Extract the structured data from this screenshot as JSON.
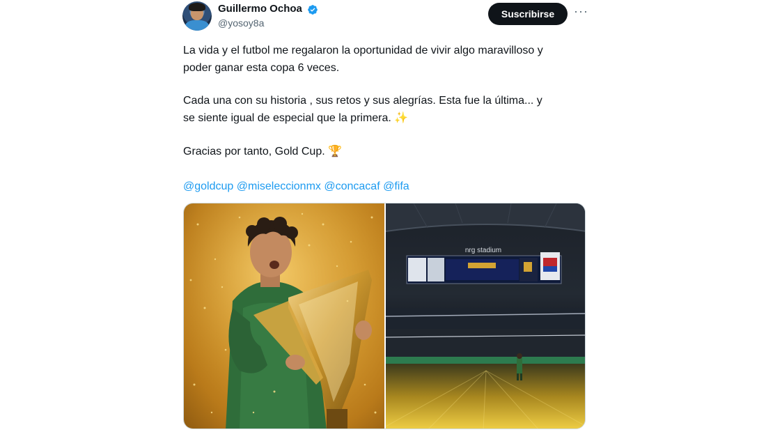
{
  "author": {
    "name": "Guillermo Ochoa",
    "handle": "@yosoy8a",
    "verified": true
  },
  "actions": {
    "subscribe_label": "Suscribirse",
    "more_label": "···"
  },
  "tweet": {
    "paragraph1_line1": "La vida y el futbol me regalaron la oportunidad de vivir algo maravilloso y",
    "paragraph1_line2": "poder ganar esta copa 6 veces.",
    "paragraph2_line1": "Cada una con su historia , sus retos y sus alegrías. Esta fue la última... y",
    "paragraph2_line2": "se siente igual de especial que la primera. ✨",
    "paragraph3": "Gracias por tanto, Gold Cup. 🏆",
    "mentions": [
      "@goldcup",
      "@miseleccionmx",
      "@concacaf",
      "@fifa"
    ]
  },
  "media": {
    "stadium_sign": "nrg stadium"
  },
  "colors": {
    "link": "#1d9bf0",
    "verified": "#1d9bf0",
    "button_bg": "#0f1419",
    "secondary_text": "#536471"
  }
}
